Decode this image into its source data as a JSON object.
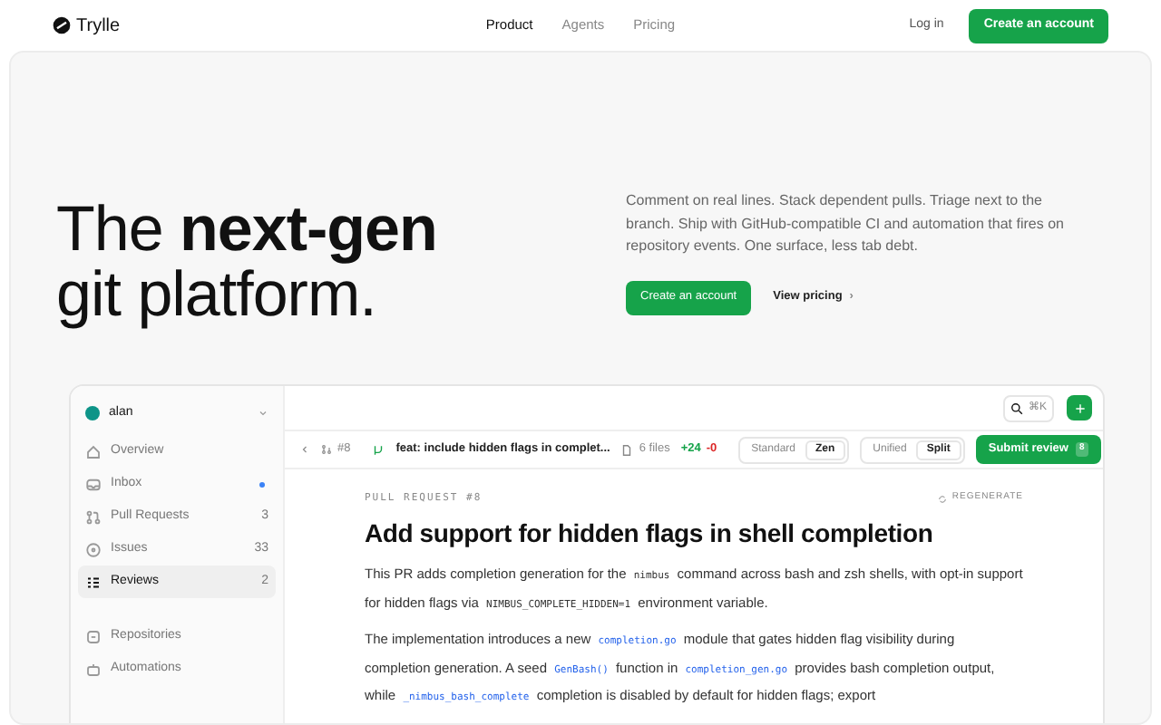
{
  "brand": "Trylle",
  "nav": [
    {
      "label": "Product",
      "selected": true
    },
    {
      "label": "Agents",
      "selected": false
    },
    {
      "label": "Pricing",
      "selected": false
    }
  ],
  "login": "Log in",
  "cta": "Create an account",
  "hero": {
    "title": "The **next-gen**\ngit platform.",
    "text": "Comment on real lines. Stack dependent pulls. Triage next to the branch. Ship with GitHub-compatible CI and automation that fires on repository events. One surface, less tab debt.",
    "primary": "Create an account",
    "secondary": "View pricing",
    "secondary_arrow": "›"
  },
  "app": {
    "user": "alan",
    "shortcut": "⌘K",
    "sidebar": [
      {
        "label": "Overview",
        "selected": false
      },
      {
        "label": "Inbox",
        "selected": false,
        "dot": true
      },
      {
        "label": "Pull Requests",
        "count": "3",
        "selected": false
      },
      {
        "label": "Issues",
        "count": "33",
        "selected": false
      },
      {
        "label": "Reviews",
        "count": "2",
        "selected": true
      }
    ],
    "sidebar_more": [
      {
        "label": "Repositories"
      },
      {
        "label": "Automations"
      }
    ],
    "pr_bar": {
      "number": "#8",
      "title": "feat: include hidden flags in complet...",
      "files": "6 files",
      "added": "+24",
      "removed": "-0",
      "mode": [
        {
          "label": "Standard",
          "selected": false
        },
        {
          "label": "Zen",
          "selected": true
        }
      ],
      "view": [
        {
          "label": "Unified",
          "selected": false
        },
        {
          "label": "Split",
          "selected": true
        }
      ],
      "submit": "Submit review",
      "submit_count": "8"
    },
    "doc": {
      "eyebrow": "PULL REQUEST #8",
      "regenerate": "REGENERATE",
      "title": "Add support for hidden flags in shell completion",
      "paragraphs": [
        [
          {
            "kind": "text",
            "text": "This PR adds completion generation for the "
          },
          {
            "kind": "code",
            "text": "nimbus"
          },
          {
            "kind": "text",
            "text": " command across bash and zsh shells, with opt-in support for hidden flags via "
          },
          {
            "kind": "code",
            "text": "NIMBUS_COMPLETE_HIDDEN=1"
          },
          {
            "kind": "text",
            "text": " environment variable."
          }
        ],
        [
          {
            "kind": "text",
            "text": "The implementation introduces a new "
          },
          {
            "kind": "link",
            "text": "completion.go"
          },
          {
            "kind": "text",
            "text": " module that gates hidden flag visibility during completion generation. A seed "
          },
          {
            "kind": "link",
            "text": "GenBash()"
          },
          {
            "kind": "text",
            "text": " function in "
          },
          {
            "kind": "link",
            "text": "completion_gen.go"
          },
          {
            "kind": "text",
            "text": " provides bash completion output, while "
          },
          {
            "kind": "link",
            "text": "_nimbus_bash_complete"
          },
          {
            "kind": "text",
            "text": " completion is disabled by default for hidden flags; export"
          }
        ]
      ]
    }
  }
}
